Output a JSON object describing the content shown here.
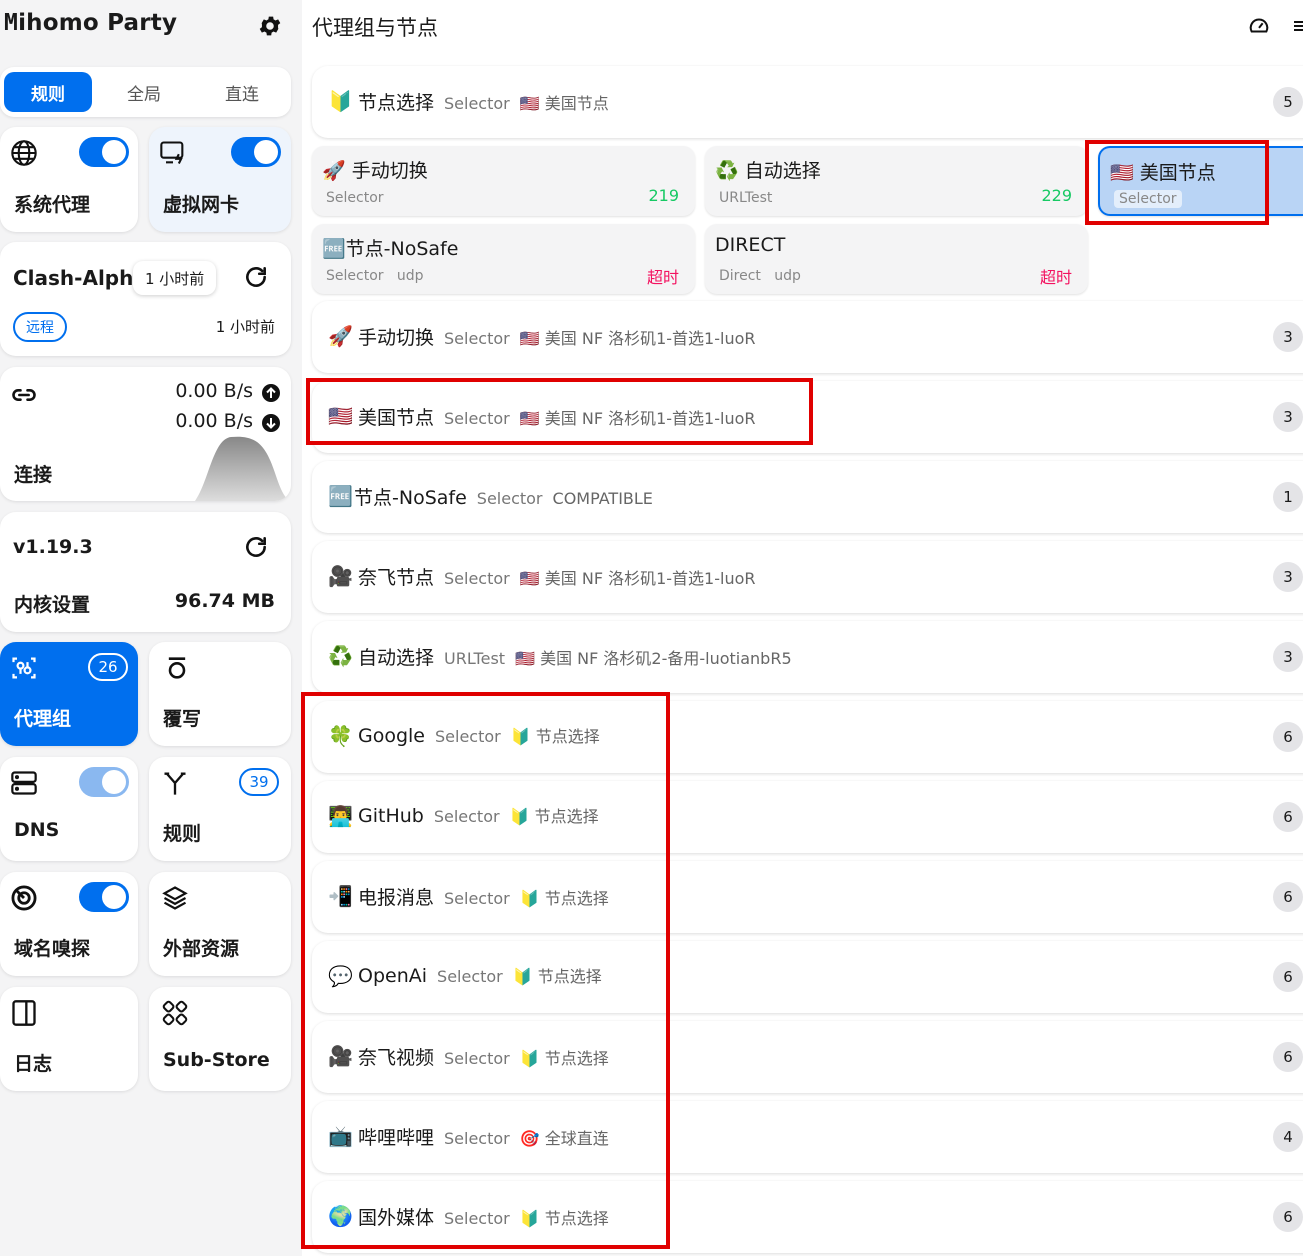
{
  "app": {
    "title_prefix": "M",
    "title_rest": "ihomo Party"
  },
  "modes": [
    "规则",
    "全局",
    "直连"
  ],
  "sidebar": {
    "system_proxy": "系统代理",
    "tun": "虚拟网卡",
    "profile": {
      "name": "Clash-Alpha-",
      "tooltip": "1 小时前",
      "tag": "远程",
      "updated": "1 小时前"
    },
    "traffic": {
      "up": "0.00 B/s",
      "down": "0.00 B/s",
      "label": "连接"
    },
    "core": {
      "version": "v1.19.3",
      "label": "内核设置",
      "memory": "96.74 MB"
    },
    "proxy_groups": {
      "label": "代理组",
      "count": "26"
    },
    "override": "覆写",
    "dns": "DNS",
    "rules": {
      "label": "规则",
      "count": "39"
    },
    "sniffer": "域名嗅探",
    "resources": "外部资源",
    "logs": "日志",
    "substore": "Sub-Store"
  },
  "main": {
    "title": "代理组与节点",
    "groups": [
      {
        "emoji": "🔰",
        "name": "节点选择",
        "type": "Selector",
        "now": "🇺🇸 美国节点",
        "count": "5"
      },
      {
        "emoji": "🚀",
        "name": "手动切换",
        "type": "Selector",
        "now": "🇺🇸 美国 NF 洛杉矶1-首选1-luoR",
        "count": "3"
      },
      {
        "emoji": "🇺🇸",
        "name": "美国节点",
        "type": "Selector",
        "now": "🇺🇸 美国 NF 洛杉矶1-首选1-luoR",
        "count": "3"
      },
      {
        "emoji": "🆓",
        "name": "节点-NoSafe",
        "type": "Selector",
        "now": "COMPATIBLE",
        "count": "1"
      },
      {
        "emoji": "🎥",
        "name": "奈飞节点",
        "type": "Selector",
        "now": "🇺🇸 美国 NF 洛杉矶1-首选1-luoR",
        "count": "3"
      },
      {
        "emoji": "♻️",
        "name": "自动选择",
        "type": "URLTest",
        "now": "🇺🇸 美国 NF 洛杉矶2-备用-luotianbR5",
        "count": "3"
      },
      {
        "emoji": "🍀",
        "name": "Google",
        "type": "Selector",
        "now": "🔰 节点选择",
        "count": "6"
      },
      {
        "emoji": "👨‍💻",
        "name": "GitHub",
        "type": "Selector",
        "now": "🔰 节点选择",
        "count": "6"
      },
      {
        "emoji": "📲",
        "name": "电报消息",
        "type": "Selector",
        "now": "🔰 节点选择",
        "count": "6"
      },
      {
        "emoji": "💬",
        "name": "OpenAi",
        "type": "Selector",
        "now": "🔰 节点选择",
        "count": "6"
      },
      {
        "emoji": "🎥",
        "name": "奈飞视频",
        "type": "Selector",
        "now": "🔰 节点选择",
        "count": "6"
      },
      {
        "emoji": "📺",
        "name": "哔哩哔哩",
        "type": "Selector",
        "now": "🎯 全球直连",
        "count": "4"
      },
      {
        "emoji": "🌍",
        "name": "国外媒体",
        "type": "Selector",
        "now": "🔰 节点选择",
        "count": "6"
      }
    ],
    "nodes": [
      {
        "name": "🚀 手动切换",
        "type": "Selector",
        "udp": "",
        "delay": "219",
        "delay_color": "#17c964"
      },
      {
        "name": "♻️ 自动选择",
        "type": "URLTest",
        "udp": "",
        "delay": "229",
        "delay_color": "#17c964"
      },
      {
        "name": "🇺🇸 美国节点",
        "type": "Selector",
        "udp": "",
        "delay": "",
        "delay_color": "#17c964"
      },
      {
        "name": "🆓节点-NoSafe",
        "type": "Selector",
        "udp": "udp",
        "delay": "超时",
        "delay_color": "#f31260"
      },
      {
        "name": "DIRECT",
        "type": "Direct",
        "udp": "udp",
        "delay": "超时",
        "delay_color": "#f31260"
      }
    ]
  },
  "colors": {
    "accent": "#006fee",
    "annotation": "#e00000",
    "success": "#17c964",
    "danger": "#f31260"
  }
}
